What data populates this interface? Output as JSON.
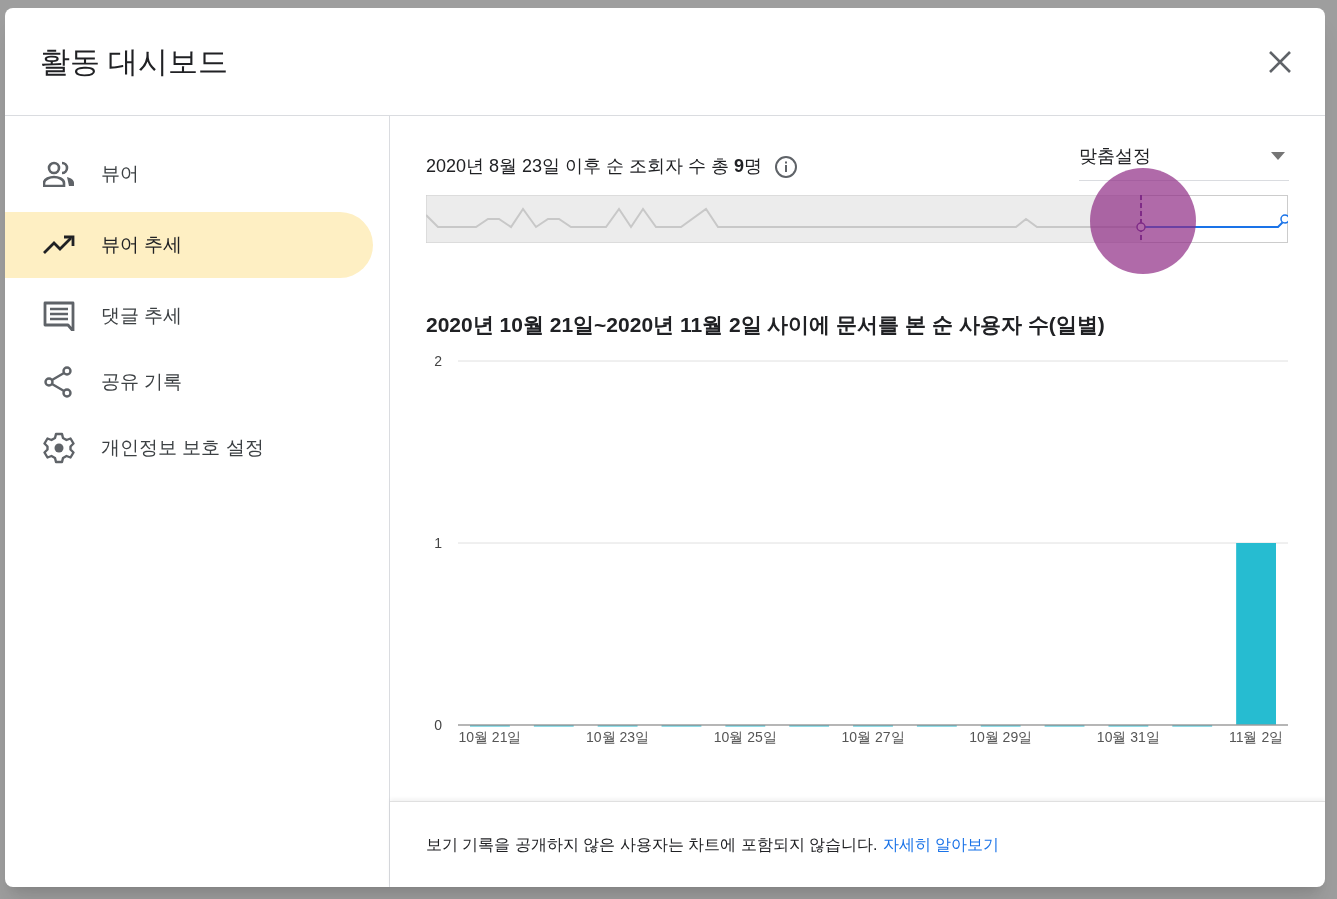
{
  "dialog": {
    "title": "활동 대시보드"
  },
  "sidebar": {
    "items": [
      {
        "kind": "people",
        "label": "뷰어",
        "selected": false
      },
      {
        "kind": "trend",
        "label": "뷰어 추세",
        "selected": true
      },
      {
        "kind": "comment",
        "label": "댓글 추세",
        "selected": false
      },
      {
        "kind": "share",
        "label": "공유 기록",
        "selected": false
      },
      {
        "kind": "settings",
        "label": "개인정보 보호 설정",
        "selected": false
      }
    ]
  },
  "summary": "2020년 8월 23일 이후 순 조회자 수 총 **9**명",
  "range_dropdown": {
    "value": "맞춤설정"
  },
  "chart": {
    "chart_data": {
      "type": "bar",
      "title": "2020년 10월 21일~2020년 11월 2일 사이에 문서를 본 순 사용자 수(일별)",
      "categories": [
        "10월 21일",
        null,
        "10월 23일",
        null,
        "10월 25일",
        null,
        "10월 27일",
        null,
        "10월 29일",
        null,
        "10월 31일",
        null,
        "11월 2일"
      ],
      "series": [
        {
          "color": "#26bcd1",
          "values": [
            0,
            0,
            0,
            0,
            0,
            0,
            0,
            0,
            0,
            0,
            0,
            0,
            1
          ]
        }
      ],
      "ylim": [
        0,
        2
      ],
      "yticks": [
        0,
        1,
        2
      ]
    }
  },
  "footer": {
    "note": "보기 기록을 공개하지 않은 사용자는 차트에 포함되지 않습니다.",
    "link": "자세히 알아보기"
  }
}
